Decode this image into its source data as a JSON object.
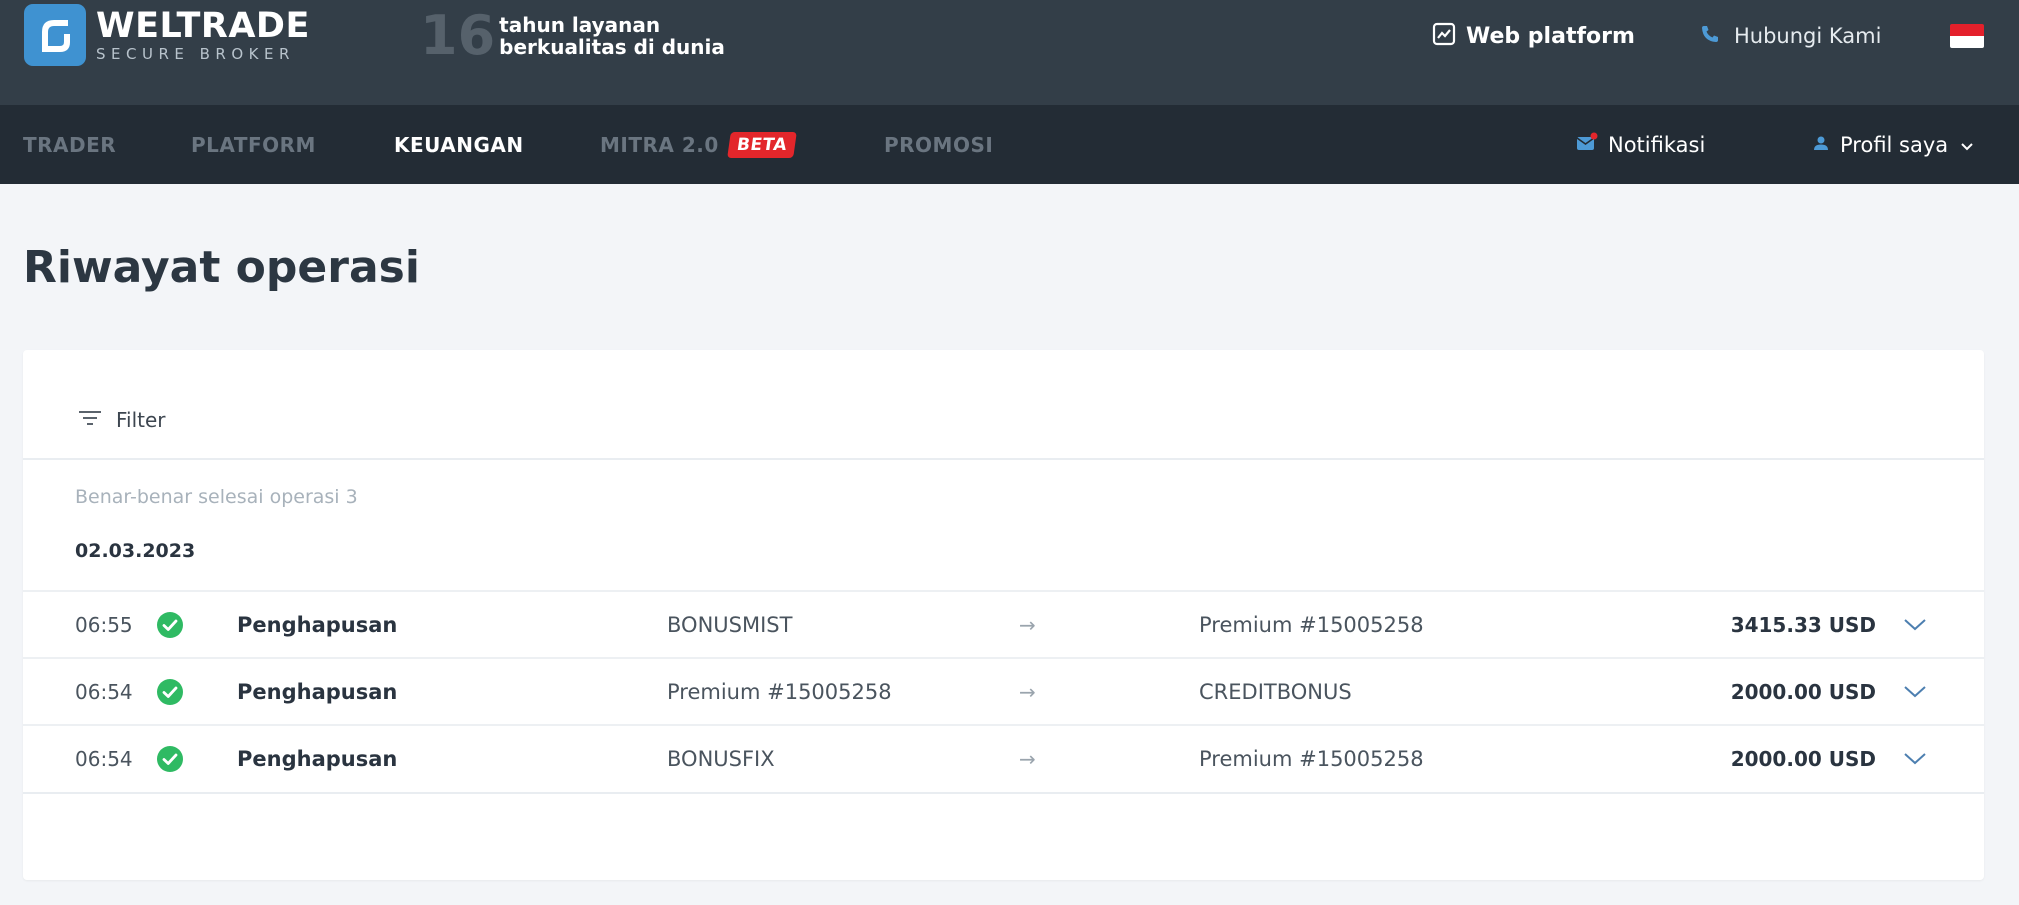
{
  "header": {
    "logo_name": "WELTRADE",
    "logo_sub": "SECURE BROKER",
    "years_number": "16",
    "years_line1": "tahun layanan",
    "years_line2": "berkualitas di dunia",
    "web_platform": "Web platform",
    "contact": "Hubungi Kami",
    "language_flag": "indonesia-flag"
  },
  "nav": {
    "items": [
      {
        "label": "TRADER"
      },
      {
        "label": "PLATFORM"
      },
      {
        "label": "KEUANGAN",
        "active": true
      },
      {
        "label": "MITRA 2.0",
        "badge": "BETA"
      },
      {
        "label": "PROMOSI"
      }
    ],
    "notifications": "Notifikasi",
    "profile": "Profil saya"
  },
  "page": {
    "title": "Riwayat operasi",
    "filter_label": "Filter",
    "summary": "Benar-benar selesai operasi 3",
    "date": "02.03.2023"
  },
  "operations": [
    {
      "time": "06:55",
      "type": "Penghapusan",
      "from": "BONUSMIST",
      "arrow": "→",
      "to": "Premium #15005258",
      "amount": "3415.33 USD"
    },
    {
      "time": "06:54",
      "type": "Penghapusan",
      "from": "Premium #15005258",
      "arrow": "→",
      "to": "CREDITBONUS",
      "amount": "2000.00 USD"
    },
    {
      "time": "06:54",
      "type": "Penghapusan",
      "from": "BONUSFIX",
      "arrow": "→",
      "to": "Premium #15005258",
      "amount": "2000.00 USD"
    }
  ],
  "colors": {
    "header_bg": "#333e48",
    "nav_bg": "#232c35",
    "brand_blue": "#3f92d1",
    "beta_red": "#e3262b",
    "success_green": "#2fba63",
    "page_bg": "#f3f5f8"
  }
}
